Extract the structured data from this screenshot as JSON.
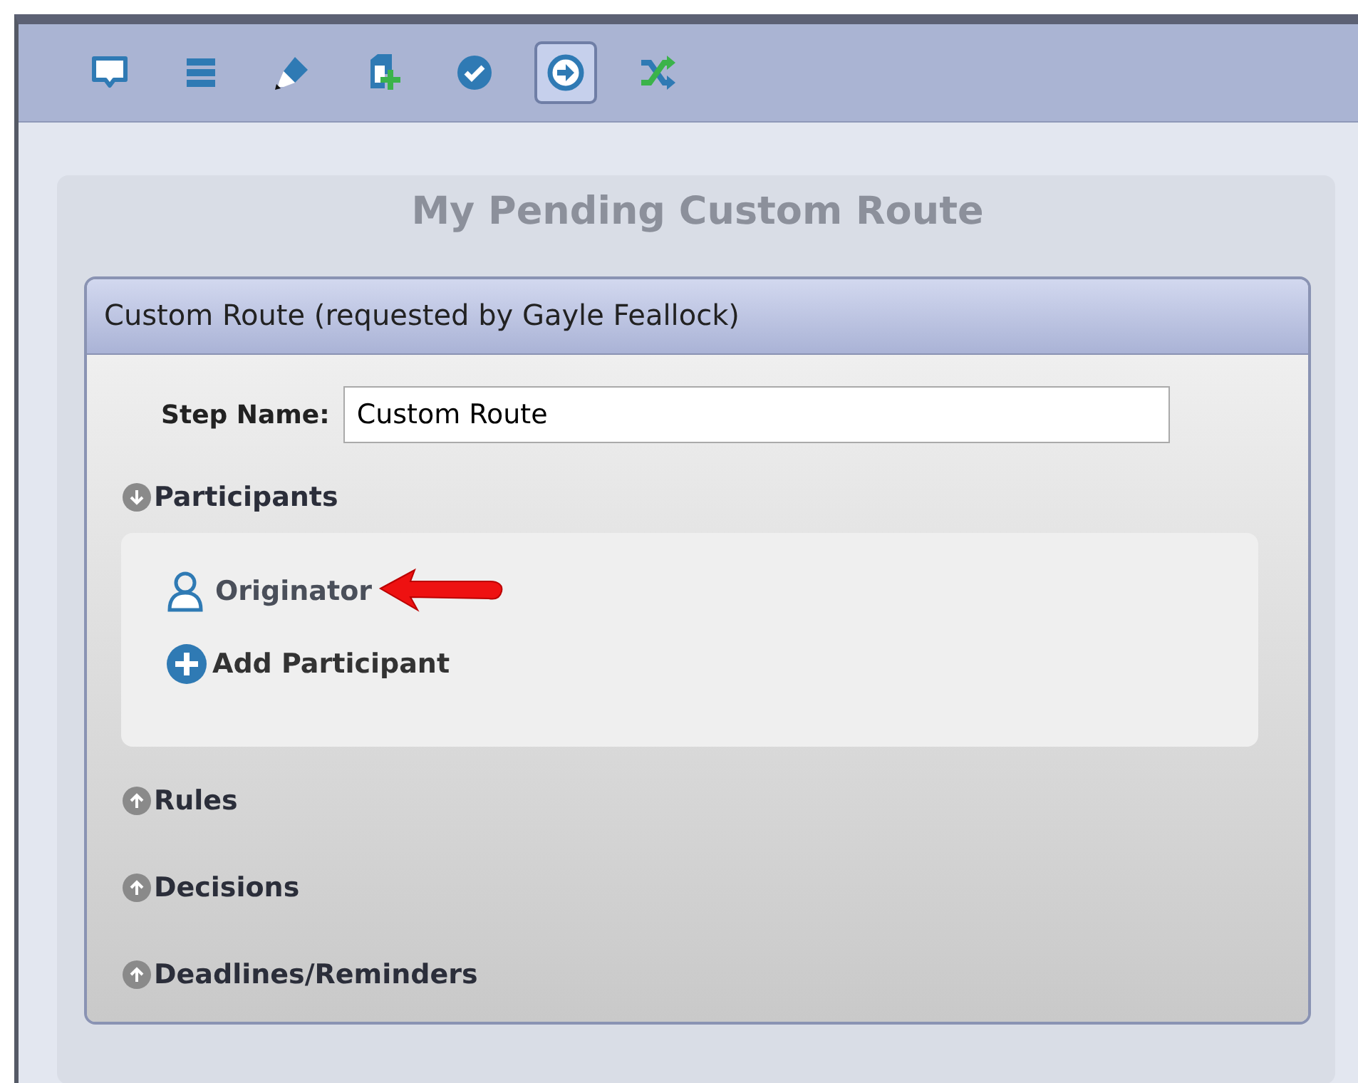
{
  "toolbar": {
    "buttons": [
      {
        "kind": "comment",
        "selected": false
      },
      {
        "kind": "list",
        "selected": false
      },
      {
        "kind": "edit",
        "selected": false
      },
      {
        "kind": "add-doc",
        "selected": false
      },
      {
        "kind": "approve",
        "selected": false
      },
      {
        "kind": "route",
        "selected": true
      },
      {
        "kind": "shuffle",
        "selected": false
      }
    ]
  },
  "page": {
    "title": "My Pending Custom Route"
  },
  "card": {
    "header": "Custom Route (requested by Gayle Feallock)",
    "step_name": {
      "label": "Step Name:",
      "value": "Custom Route"
    },
    "sections": [
      {
        "label": "Participants",
        "expanded": true,
        "items": [
          {
            "kind": "person",
            "label": "Originator",
            "highlighted": true
          },
          {
            "kind": "add",
            "label": "Add Participant",
            "highlighted": false
          }
        ]
      },
      {
        "label": "Rules",
        "expanded": false
      },
      {
        "label": "Decisions",
        "expanded": false
      },
      {
        "label": "Deadlines/Reminders",
        "expanded": false
      }
    ]
  }
}
